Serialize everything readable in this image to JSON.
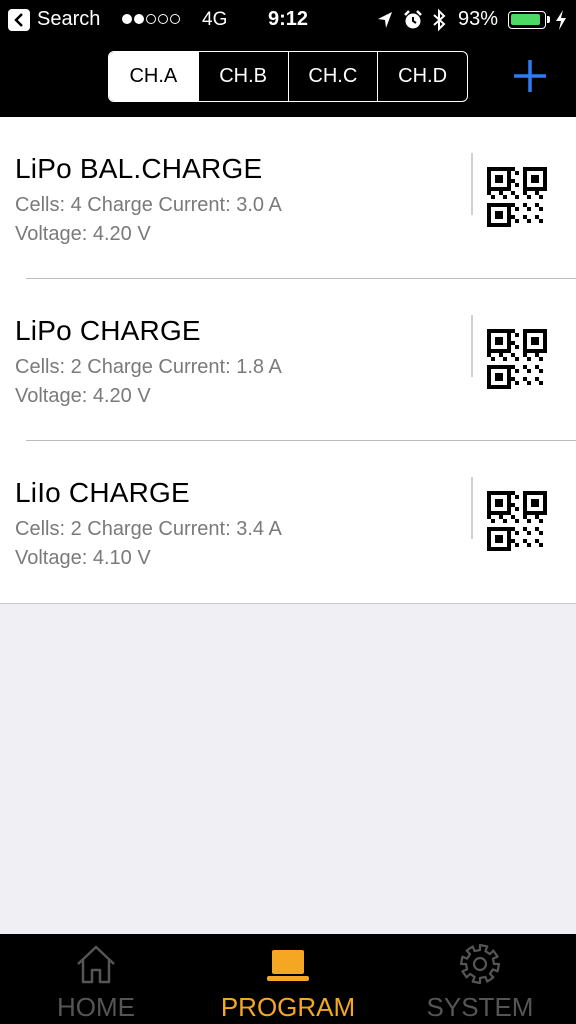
{
  "status_bar": {
    "back_label": "Search",
    "network": "4G",
    "time": "9:12",
    "battery_percent": "93%",
    "battery_level": 0.93,
    "signal_bars_filled": 2,
    "signal_bars_total": 5
  },
  "nav": {
    "channels": [
      {
        "label": "CH.A",
        "active": true
      },
      {
        "label": "CH.B",
        "active": false
      },
      {
        "label": "CH.C",
        "active": false
      },
      {
        "label": "CH.D",
        "active": false
      }
    ],
    "add_icon": "plus-icon"
  },
  "programs": [
    {
      "title": "LiPo  BAL.CHARGE",
      "line1": "Cells: 4  Charge Current: 3.0 A",
      "line2": "Voltage: 4.20 V"
    },
    {
      "title": "LiPo  CHARGE",
      "line1": "Cells: 2  Charge Current: 1.8 A",
      "line2": "Voltage: 4.20 V"
    },
    {
      "title": "LiIo  CHARGE",
      "line1": "Cells: 2  Charge Current: 3.4 A",
      "line2": "Voltage: 4.10 V"
    }
  ],
  "tabs": [
    {
      "label": "HOME",
      "icon": "home-icon",
      "active": false
    },
    {
      "label": "PROGRAM",
      "icon": "laptop-icon",
      "active": true
    },
    {
      "label": "SYSTEM",
      "icon": "gear-icon",
      "active": false
    }
  ],
  "colors": {
    "accent_blue": "#2b7cf6",
    "active_tab": "#f5a623",
    "inactive_tab": "#555555",
    "battery_green": "#4cd964"
  }
}
